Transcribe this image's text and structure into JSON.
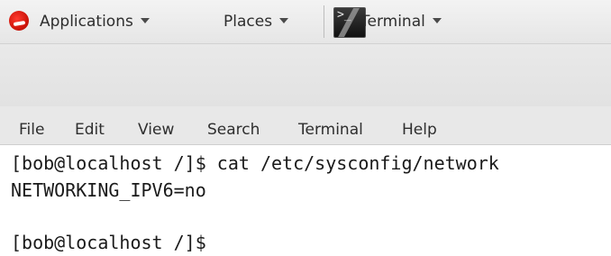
{
  "top_panel": {
    "applications_label": "Applications",
    "places_label": "Places",
    "terminal_task_label": "Terminal",
    "terminal_icon_glyph": ">_"
  },
  "terminal_window": {
    "menubar": {
      "file": "File",
      "edit": "Edit",
      "view": "View",
      "search": "Search",
      "terminal": "Terminal",
      "help": "Help"
    },
    "lines": [
      "[bob@localhost /]$ cat /etc/sysconfig/network",
      "NETWORKING_IPV6=no",
      "",
      "[bob@localhost /]$"
    ]
  }
}
